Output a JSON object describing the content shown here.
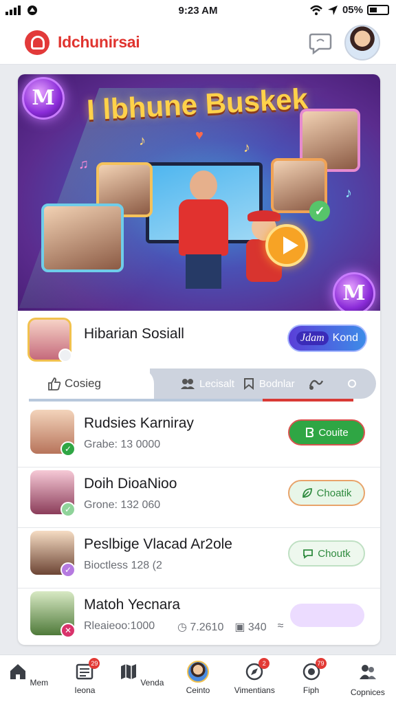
{
  "status_bar": {
    "time": "9:23 AM",
    "battery": "05%"
  },
  "header": {
    "app_name": "Idchunirsai"
  },
  "hero": {
    "title": "I lbhune Buskek",
    "orb_glyph": "M"
  },
  "community": {
    "name": "Hibarian Sosiall",
    "join_prefix": "Jdam",
    "join_label": "Kond"
  },
  "tabs": [
    {
      "label": "Cosieg"
    },
    {
      "label": "Lecisalt"
    },
    {
      "label": "Bodnlar"
    }
  ],
  "list": [
    {
      "title": "Rudsies Karniray",
      "subtitle": "Grabe: 13 0000",
      "button": "Couite",
      "button_style": "green",
      "badge_color": "#2fa644",
      "badge_glyph": "✓"
    },
    {
      "title": "Doih DioaNioo",
      "subtitle": "Grone: 132 060",
      "button": "Choatik",
      "button_style": "light",
      "badge_color": "#8fd39a",
      "badge_glyph": "✓"
    },
    {
      "title": "Peslbige Vlacad Ar2ole",
      "subtitle": "Bioctless   128 (2",
      "button": "Choutk",
      "button_style": "light2",
      "badge_color": "#b57ae0",
      "badge_glyph": "✓"
    },
    {
      "title": "Matoh Yecnara",
      "subtitle": "Rleaieoo:1000",
      "stat1": "7.2610",
      "stat2": "340",
      "badge_color": "#d9336b",
      "badge_glyph": "✕"
    }
  ],
  "nav": [
    {
      "label": "Mem",
      "icon": "home-icon",
      "badge": ""
    },
    {
      "label": "Ieona",
      "icon": "news-icon",
      "badge": "29"
    },
    {
      "label": "Venda",
      "icon": "map-icon",
      "badge": ""
    },
    {
      "label": "Ceinto",
      "icon": "avatar-icon",
      "badge": ""
    },
    {
      "label": "Vimentians",
      "icon": "compass-icon",
      "badge": "2"
    },
    {
      "label": "Fiph",
      "icon": "target-icon",
      "badge": "79"
    },
    {
      "label": "Copnices",
      "icon": "group-icon",
      "badge": ""
    }
  ]
}
